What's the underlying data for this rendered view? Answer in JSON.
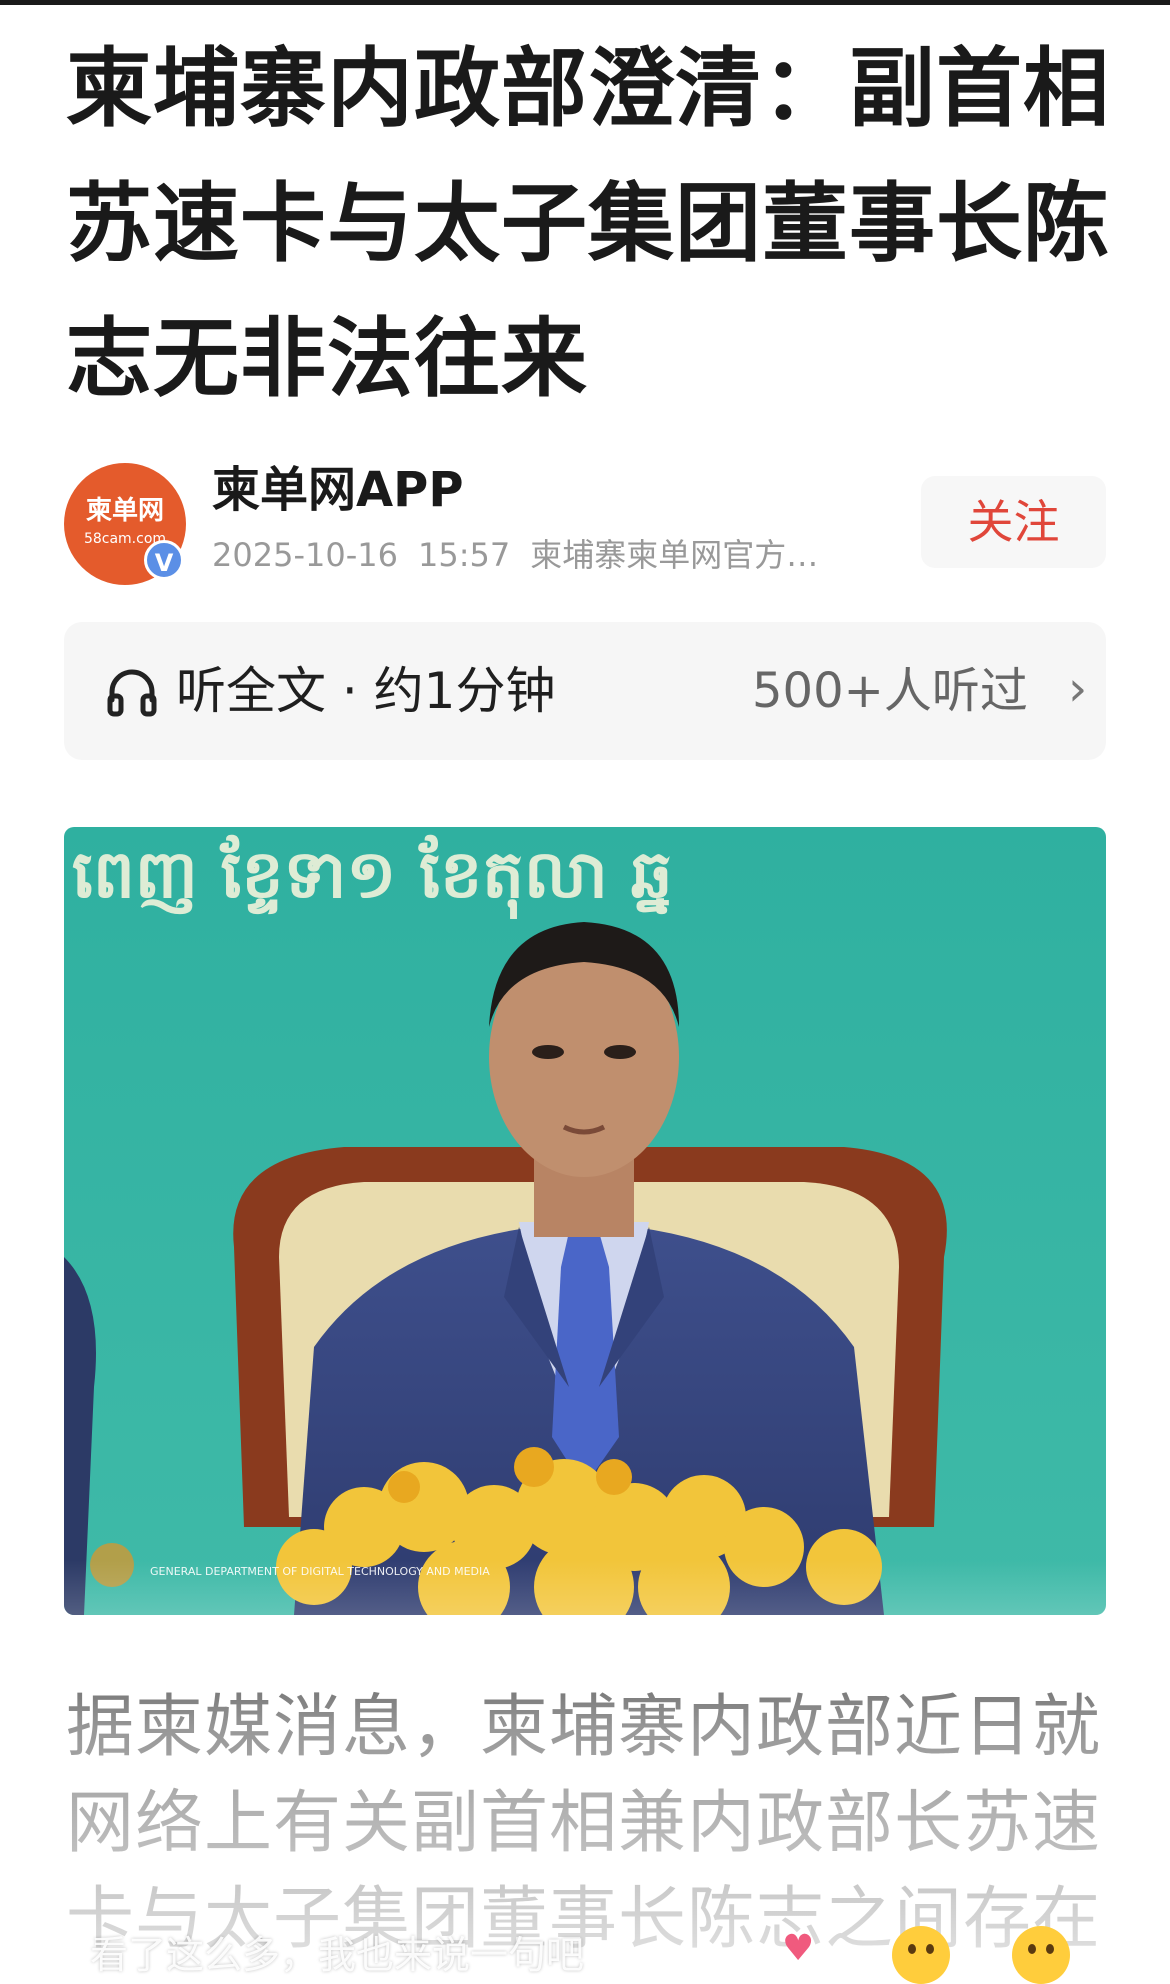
{
  "article": {
    "title": "柬埔寨内政部澄清：副首相苏速卡与太子集团董事长陈志无非法往来"
  },
  "author": {
    "avatar_text": "柬单网",
    "avatar_subtext": "58cam.com",
    "verified_badge": "V",
    "name": "柬单网APP",
    "date": "2025-10-16",
    "time": "15:57",
    "source": "柬埔寨柬单网官方…",
    "follow_label": "关注"
  },
  "listen": {
    "icon": "headphones-icon",
    "label": "听全文 · 约1分钟",
    "count": "500+人听过",
    "chevron": "›"
  },
  "photo": {
    "banner_text": "ពេញ ខ្ទែទា១ ខែតុលា ឆ្ន",
    "caption_text": "GENERAL DEPARTMENT OF DIGITAL TECHNOLOGY AND MEDIA"
  },
  "body": {
    "paragraph": "据柬媒消息，柬埔寨内政部近日就网络上有关副首相兼内政部长苏速卡与太子集团董事长陈志之间存在"
  },
  "overlay": {
    "comment_text": "看了这么多，我也来说一句吧",
    "emoji": "laughing-emoji-icon"
  },
  "colors": {
    "follow": "#e0463a",
    "avatar": "#e45b2c",
    "verified": "#5b8fe6",
    "photo_background": "#2fb0a0"
  }
}
